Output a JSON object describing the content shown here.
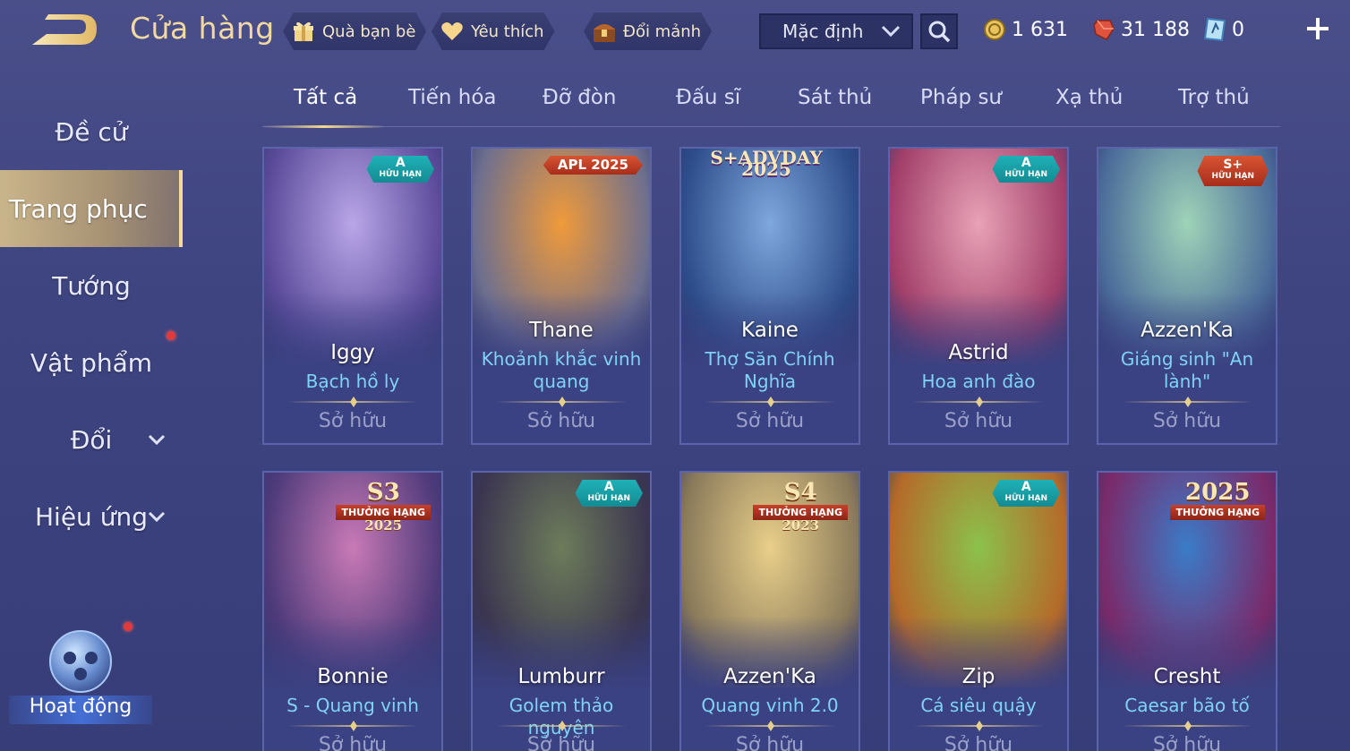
{
  "store_title": "Cửa hàng",
  "top_buttons": {
    "friend_gift": "Quà bạn bè",
    "favorites": "Yêu thích",
    "exchange_fragments": "Đổi mảnh"
  },
  "sort": {
    "selected": "Mặc định"
  },
  "currencies": {
    "gold": "1 631",
    "vouchers": "31 188",
    "diamonds": "0"
  },
  "sidebar": {
    "items": [
      {
        "label": "Đề cử"
      },
      {
        "label": "Trang phục"
      },
      {
        "label": "Tướng"
      },
      {
        "label": "Vật phẩm"
      },
      {
        "label": "Đổi"
      },
      {
        "label": "Hiệu ứng"
      }
    ],
    "activity_label": "Hoạt động"
  },
  "tabs": [
    "Tất cả",
    "Tiến hóa",
    "Đỡ đòn",
    "Đấu sĩ",
    "Sát thủ",
    "Pháp sư",
    "Xạ thủ",
    "Trợ thủ"
  ],
  "cards": [
    {
      "hero": "Iggy",
      "skin": "Bạch hồ ly",
      "status": "Sở hữu",
      "badge": "A HỮU HẠN",
      "badge_type": "teal",
      "colors": [
        "#b9a6e8",
        "#5b4b9a"
      ]
    },
    {
      "hero": "Thane",
      "skin": "Khoảnh khắc vinh quang",
      "status": "Sở hữu",
      "badge": "APL 2025",
      "badge_type": "red",
      "colors": [
        "#f09a3a",
        "#6d6f8f"
      ]
    },
    {
      "hero": "Kaine",
      "skin": "Thợ Săn Chính Nghĩa",
      "status": "Sở hữu",
      "badge": "S+ADVDAY 2025",
      "badge_type": "text",
      "colors": [
        "#7fa8de",
        "#2d4d8a"
      ]
    },
    {
      "hero": "Astrid",
      "skin": "Hoa anh đào",
      "status": "Sở hữu",
      "badge": "A HỮU HẠN",
      "badge_type": "teal",
      "colors": [
        "#e8a2b6",
        "#a23f6a"
      ]
    },
    {
      "hero": "Azzen'Ka",
      "skin": "Giáng sinh \"An lành\"",
      "status": "Sở hữu",
      "badge": "S+ HỮU HẠN",
      "badge_type": "red",
      "colors": [
        "#9fd3b8",
        "#4b6c9a"
      ]
    },
    {
      "hero": "Bonnie",
      "skin": "S - Quang vinh",
      "status": "Sở hữu",
      "badge": "S3 THƯỞNG HẠNG 2025",
      "badge_type": "rank",
      "colors": [
        "#c97ab6",
        "#4e3a7a"
      ]
    },
    {
      "hero": "Lumburr",
      "skin": "Golem thảo nguyên",
      "status": "Sở hữu",
      "badge": "A HỮU HẠN",
      "badge_type": "teal",
      "colors": [
        "#6d7c5a",
        "#3b3550"
      ]
    },
    {
      "hero": "Azzen'Ka",
      "skin": "Quang vinh 2.0",
      "status": "Sở hữu",
      "badge": "S4 THƯỞNG HẠNG 2023",
      "badge_type": "rank",
      "colors": [
        "#e9cf8a",
        "#8a7a5a"
      ]
    },
    {
      "hero": "Zip",
      "skin": "Cá siêu quậy",
      "status": "Sở hữu",
      "badge": "A HỮU HẠN",
      "badge_type": "teal",
      "colors": [
        "#8bc24c",
        "#b56a2a"
      ]
    },
    {
      "hero": "Cresht",
      "skin": "Caesar bão tố",
      "status": "Sở hữu",
      "badge": "2025 THƯỞNG HẠNG",
      "badge_type": "rank",
      "colors": [
        "#3a7cc8",
        "#7a2a6a"
      ]
    }
  ]
}
